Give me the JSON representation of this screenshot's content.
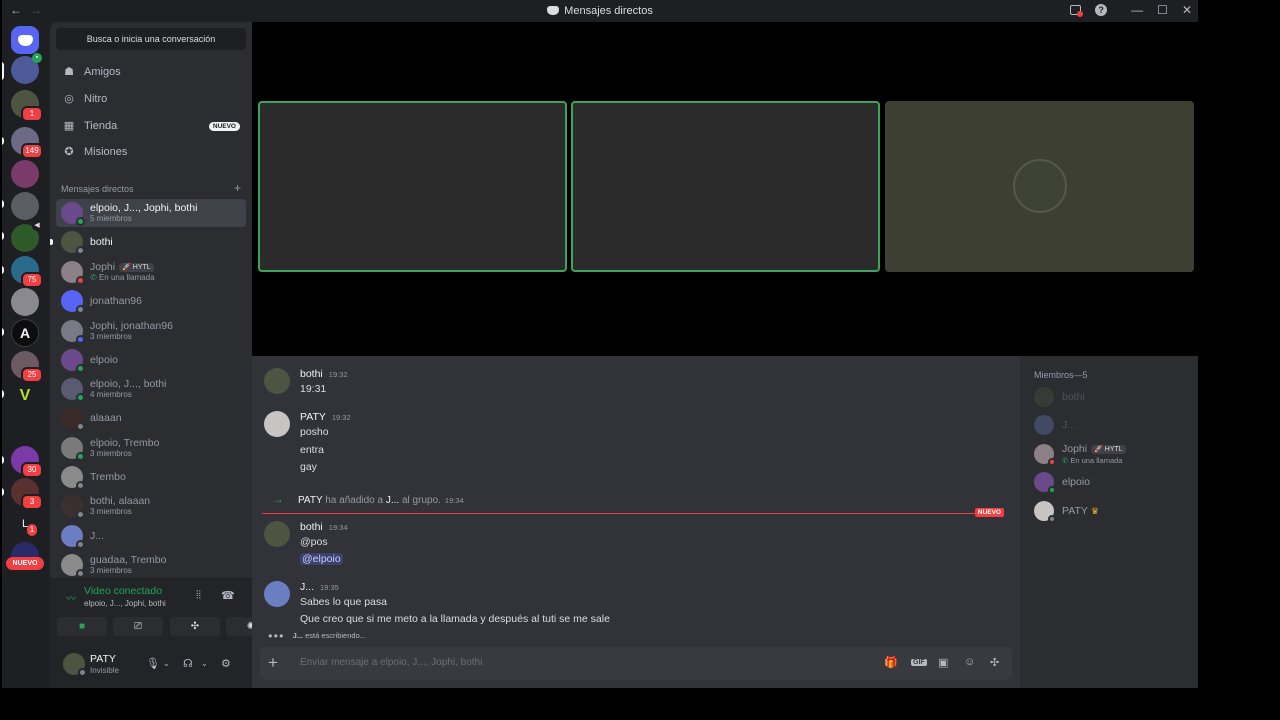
{
  "titlebar": {
    "title": "Mensajes directos",
    "back": "←",
    "forward": "→",
    "minimize": "—",
    "maximize": "☐",
    "close": "✕",
    "help": "?"
  },
  "servers": [
    {
      "badge": ""
    },
    {
      "badge": ""
    },
    {
      "badge": "1"
    },
    {
      "badge": "149"
    },
    {
      "badge": ""
    },
    {
      "badge": ""
    },
    {
      "badge": ""
    },
    {
      "badge": "75"
    },
    {
      "badge": ""
    },
    {
      "badge": ""
    },
    {
      "badge": "25"
    },
    {
      "badge": ""
    },
    {
      "badge": ""
    },
    {
      "badge": "30"
    },
    {
      "badge": "3"
    },
    {
      "badge": "1"
    }
  ],
  "server_glyphs": {
    "a_icon": "A",
    "v_icon": "V",
    "l_icon": "L"
  },
  "nuevo_server_pill": "NUEVO",
  "sidebar": {
    "search": "Busca o inicia una conversación",
    "nav": [
      {
        "label": "Amigos",
        "icon": "friends-icon"
      },
      {
        "label": "Nitro",
        "icon": "nitro-icon"
      },
      {
        "label": "Tienda",
        "icon": "shop-icon",
        "tag": "NUEVO"
      },
      {
        "label": "Misiones",
        "icon": "quests-icon"
      }
    ],
    "dm_header": "Mensajes directos",
    "dms": [
      {
        "name": "elpoio, J..., Jophi, bothi",
        "sub": "5 miembros"
      },
      {
        "name": "bothi",
        "sub": ""
      },
      {
        "name": "Jophi",
        "tag": "HYTL",
        "sub": "En una llamada"
      },
      {
        "name": "jonathan96",
        "sub": ""
      },
      {
        "name": "Jophi, jonathan96",
        "sub": "3 miembros"
      },
      {
        "name": "elpoio",
        "sub": ""
      },
      {
        "name": "elpoio, J..., bothi",
        "sub": "4 miembros"
      },
      {
        "name": "alaaan",
        "sub": ""
      },
      {
        "name": "elpoio, Trembo",
        "sub": "3 miembros"
      },
      {
        "name": "Trembo",
        "sub": ""
      },
      {
        "name": "bothi, alaaan",
        "sub": "3 miembros"
      },
      {
        "name": "J...",
        "sub": ""
      },
      {
        "name": "guadaa, Trembo",
        "sub": "3 miembros"
      }
    ]
  },
  "voice": {
    "status": "Video conectado",
    "channel": "elpoio, J..., Jophi, bothi"
  },
  "user": {
    "name": "PATY",
    "status": "Invisible"
  },
  "chat": {
    "messages": [
      {
        "author": "bothi",
        "time": "19:32",
        "lines": [
          "19:31"
        ]
      },
      {
        "author": "PATY",
        "time": "19:32",
        "lines": [
          "posho",
          "entra",
          "gay"
        ]
      },
      {
        "author": "bothi",
        "time": "19:34",
        "lines": [
          "@pos",
          "@elpoio"
        ]
      },
      {
        "author": "J...",
        "time": "19:35",
        "lines": [
          "Sabes lo que pasa",
          "Que creo que si me meto a la llamada y después al tuti se me sale"
        ]
      }
    ],
    "system": {
      "actor": "PATY",
      "text1": "ha añadido a",
      "target": "J...",
      "text2": "al grupo.",
      "time": "19:34"
    },
    "new_marker": "NUEVO",
    "typing": {
      "who": "J...",
      "text": "está escribiendo..."
    },
    "input_placeholder": "Enviar mensaje a elpoio, J..., Jophi, bothi"
  },
  "members": {
    "header": "Miembros—5",
    "list": [
      {
        "name": "bothi",
        "sub": ""
      },
      {
        "name": "J...",
        "sub": ""
      },
      {
        "name": "Jophi",
        "tag": "HYTL",
        "sub": "En una llamada"
      },
      {
        "name": "elpoio",
        "sub": ""
      },
      {
        "name": "PATY",
        "sub": ""
      }
    ]
  },
  "colors": {
    "accent": "#5865f2",
    "online": "#23a55a",
    "danger": "#f23f43",
    "speaking": "#3ba55c"
  }
}
